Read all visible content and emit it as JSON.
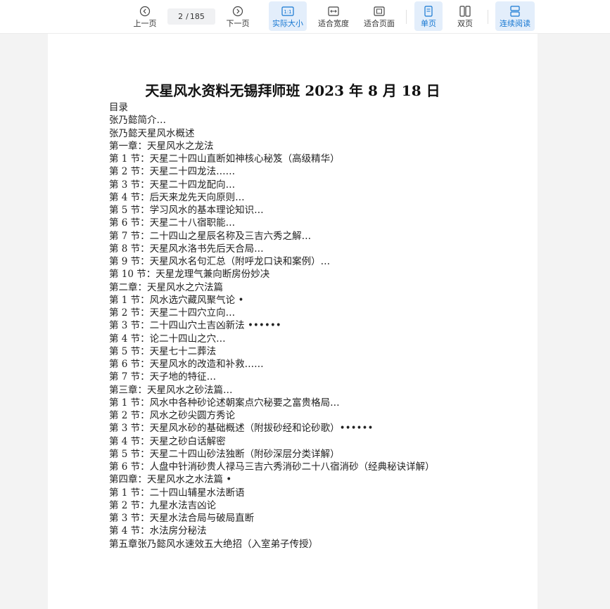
{
  "toolbar": {
    "prev_label": "上一页",
    "next_label": "下一页",
    "current_page": "2",
    "total_pages": "185",
    "actual_size_label": "实际大小",
    "fit_width_label": "适合宽度",
    "fit_page_label": "适合页面",
    "single_page_label": "单页",
    "double_page_label": "双页",
    "continuous_label": "连续阅读",
    "accent_color": "#1677d2",
    "active_bg": "#e3eefb",
    "icons": {
      "prev": "chevron-left-circle-icon",
      "next": "chevron-right-circle-icon",
      "actual_size": "one-to-one-icon",
      "fit_width": "fit-width-icon",
      "fit_page": "fit-page-icon",
      "single_page": "single-page-icon",
      "double_page": "double-page-icon",
      "continuous": "continuous-scroll-icon"
    },
    "active_items": [
      "actual_size",
      "single_page",
      "continuous"
    ]
  },
  "document": {
    "title": "天星风水资料无锡拜师班 2023 年 8 月 18 日",
    "toc": [
      "目录",
      "张乃懿简介…",
      "张乃懿天星风水概述",
      "第一章：天星风水之龙法",
      "第 1 节：天星二十四山直断如神核心秘笈（高级精华）",
      "第 2 节：天星二十四龙法……",
      "第 3 节：天星二十四龙配向…",
      "第 4 节：后天来龙先天向原则…",
      "第 5 节：学习风水的基本理论知识…",
      "第 6 节：天星二十八宿职能…",
      "第 7 节：二十四山之星辰名称及三吉六秀之解…",
      "第 8 节：天星风水洛书先后天合局…",
      "第 9 节：天星风水名句汇总（附呼龙口诀和案例）…",
      "第 10 节：天星龙理气兼向断房份妙决",
      "第二章：天星风水之穴法篇",
      "第 1 节：风水选穴藏风聚气论 •",
      "第 2 节：天星二十四穴立向…",
      "第 3 节：二十四山穴土吉凶新法 ••••••",
      "第 4 节：论二十四山之穴…",
      "第 5 节：天星七十二葬法",
      "第 6 节：天星风水的改造和补救……",
      "第 7 节：天子地的特征…",
      "第三章：天星风水之砂法篇…",
      "第 1 节：风水中各种砂论述朝案点穴秘要之富贵格局…",
      "第 2 节：风水之砂尖圆方秀论",
      "第 3 节：天星风水砂的基础概述（附拔砂经和论砂歌）••••••",
      "第 4 节：天星之砂白话解密",
      "第 5 节：天星二十四山砂法独断（附砂深层分类详解）",
      "第 6 节：人盘中针消砂贵人禄马三吉六秀消砂二十八宿消砂（经典秘诀详解）",
      "第四章：天星风水之水法篇 •",
      "第 1 节：二十四山辅星水法断语",
      "第 2 节：九星水法吉凶论",
      "第 3 节：天星水法合局与破局直断",
      "第 4 节：水法房分秘法",
      "第五章张乃懿风水速效五大绝招（入室弟子传授）"
    ]
  }
}
